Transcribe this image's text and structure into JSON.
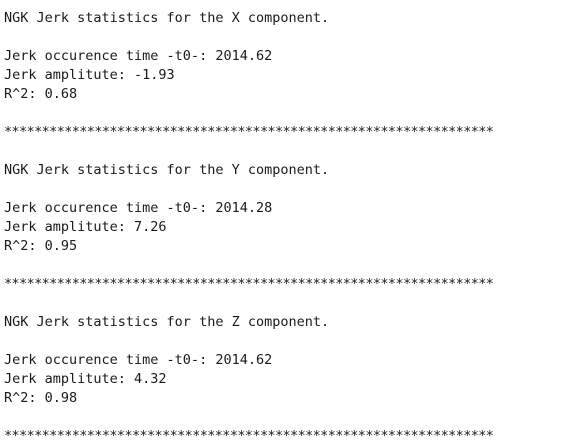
{
  "output": {
    "sections": [
      {
        "header": "NGK Jerk statistics for the X component.",
        "time": "Jerk occurence time -t0-: 2014.62",
        "amplitude": "Jerk amplitute: -1.93",
        "r2": "R^2: 0.68"
      },
      {
        "header": "NGK Jerk statistics for the Y component.",
        "time": "Jerk occurence time -t0-: 2014.28",
        "amplitude": "Jerk amplitute: 7.26",
        "r2": "R^2: 0.95"
      },
      {
        "header": "NGK Jerk statistics for the Z component.",
        "time": "Jerk occurence time -t0-: 2014.62",
        "amplitude": "Jerk amplitute: 4.32",
        "r2": "R^2: 0.98"
      }
    ],
    "separator": "*****************************************************************"
  }
}
